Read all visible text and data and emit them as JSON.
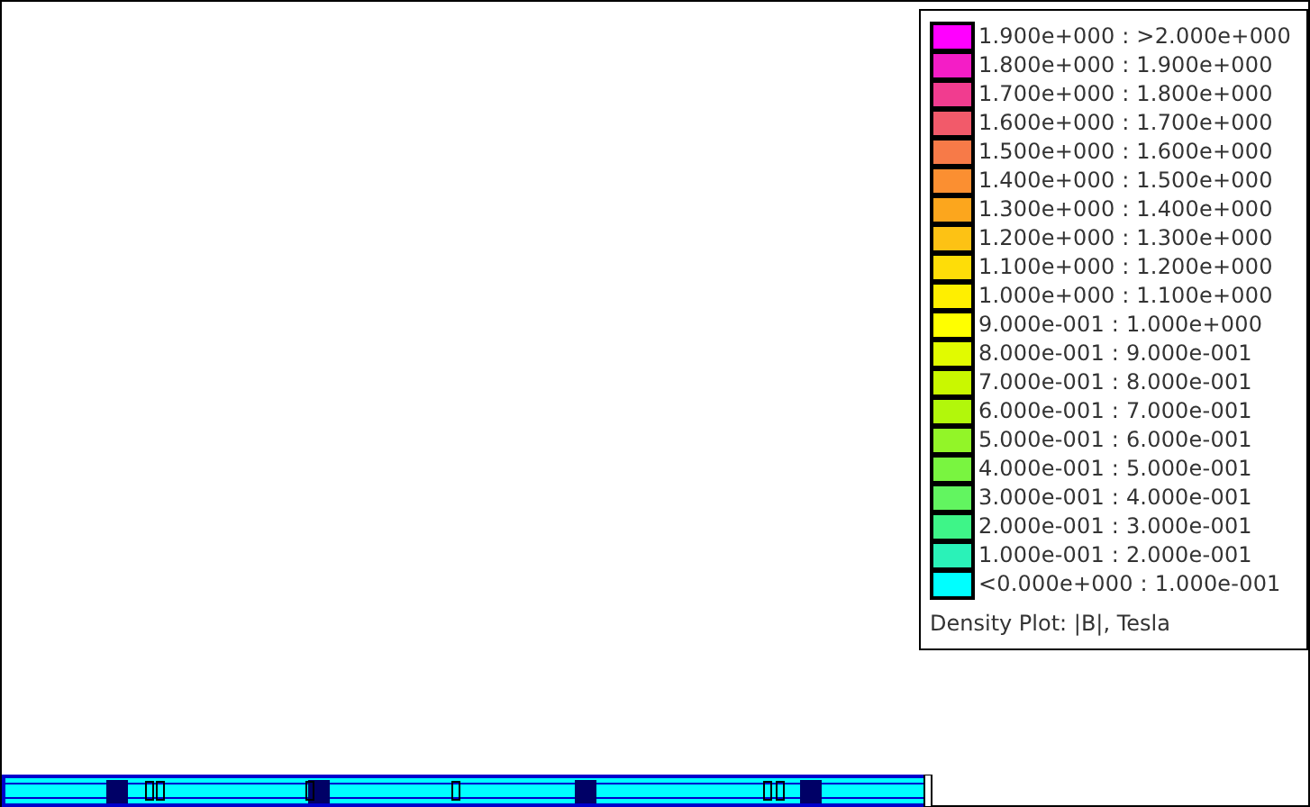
{
  "legend": {
    "entries": [
      {
        "label": "1.900e+000 : >2.000e+000",
        "color": "#ff00ff"
      },
      {
        "label": "1.800e+000 : 1.900e+000",
        "color": "#f41dc6"
      },
      {
        "label": "1.700e+000 : 1.800e+000",
        "color": "#f13c8f"
      },
      {
        "label": "1.600e+000 : 1.700e+000",
        "color": "#f25a6a"
      },
      {
        "label": "1.500e+000 : 1.600e+000",
        "color": "#f77a48"
      },
      {
        "label": "1.400e+000 : 1.500e+000",
        "color": "#fb8f31"
      },
      {
        "label": "1.300e+000 : 1.400e+000",
        "color": "#fca61d"
      },
      {
        "label": "1.200e+000 : 1.300e+000",
        "color": "#fdc214"
      },
      {
        "label": "1.100e+000 : 1.200e+000",
        "color": "#fedd08"
      },
      {
        "label": "1.000e+000 : 1.100e+000",
        "color": "#ffef00"
      },
      {
        "label": "9.000e-001 : 1.000e+000",
        "color": "#ffff00"
      },
      {
        "label": "8.000e-001 : 9.000e-001",
        "color": "#e1fb00"
      },
      {
        "label": "7.000e-001 : 8.000e-001",
        "color": "#c9f800"
      },
      {
        "label": "6.000e-001 : 7.000e-001",
        "color": "#b2f70b"
      },
      {
        "label": "5.000e-001 : 6.000e-001",
        "color": "#92f528"
      },
      {
        "label": "4.000e-001 : 5.000e-001",
        "color": "#79f540"
      },
      {
        "label": "3.000e-001 : 4.000e-001",
        "color": "#62f560"
      },
      {
        "label": "2.000e-001 : 3.000e-001",
        "color": "#3ef588"
      },
      {
        "label": "1.000e-001 : 2.000e-001",
        "color": "#2af2b8"
      },
      {
        "label": "<0.000e+000 : 1.000e-001",
        "color": "#00ffff"
      }
    ],
    "caption": "Density Plot: |B|, Tesla"
  }
}
